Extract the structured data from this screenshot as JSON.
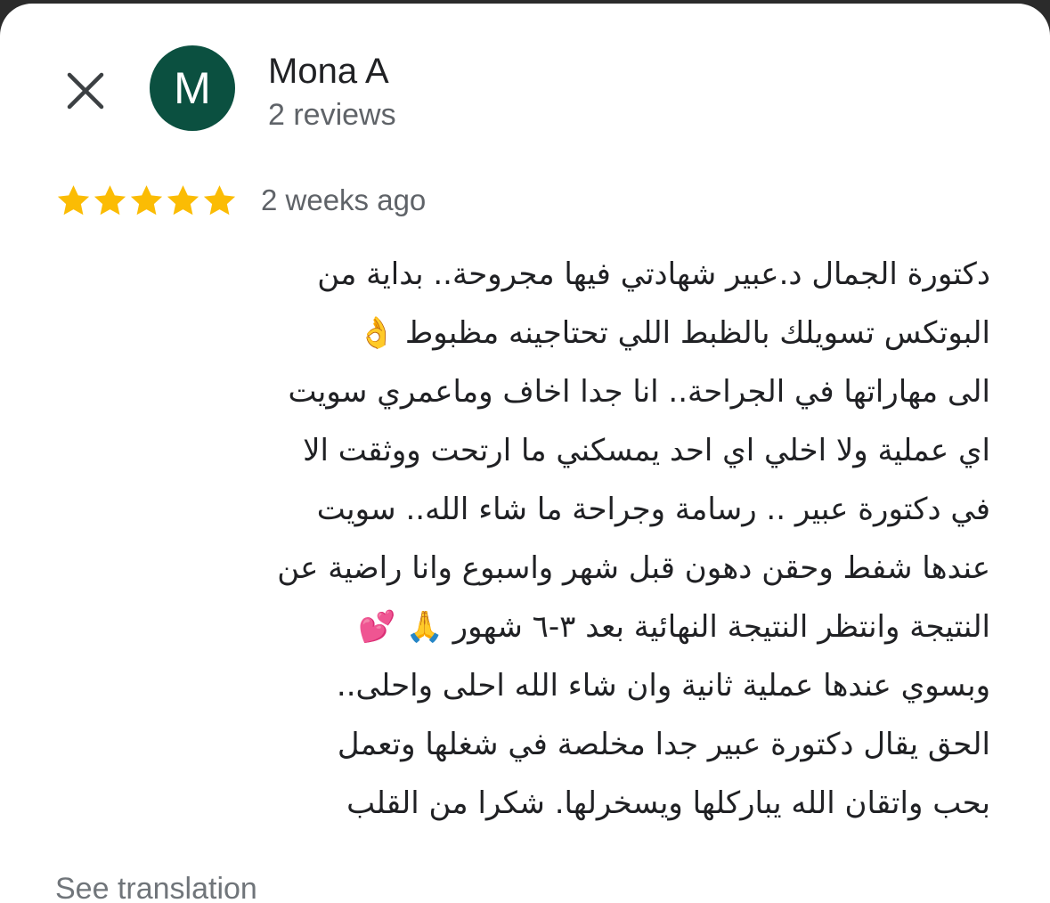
{
  "reviewer": {
    "name": "Mona A",
    "avatar_initial": "M",
    "review_count": "2 reviews"
  },
  "review": {
    "rating": 5,
    "rating_max": 5,
    "time_ago": "2 weeks ago",
    "text_lines": [
      "دكتورة الجمال د.عبير شهادتي فيها مجروحة.. بداية من",
      "البوتكس تسويلك بالظبط اللي تحتاجينه مظبوط 👌",
      "الى مهاراتها في الجراحة.. انا جدا اخاف وماعمري سويت",
      "اي عملية ولا اخلي اي احد يمسكني ما ارتحت ووثقت الا",
      "في دكتورة عبير .. رسامة وجراحة ما شاء الله.. سويت",
      "عندها شفط وحقن دهون  قبل شهر واسبوع وانا راضية عن",
      "النتيجة وانتظر النتيجة النهائية بعد ٣-٦ شهور 🙏 💕",
      "وبسوي عندها عملية ثانية وان شاء الله احلى واحلى..",
      "الحق يقال دكتورة عبير جدا مخلصة في شغلها وتعمل",
      "بحب واتقان الله يباركلها ويسخرلها. شكرا من القلب"
    ],
    "see_translation_label": "See translation"
  },
  "icons": {
    "close": "close-icon",
    "star": "star-icon"
  },
  "colors": {
    "avatar_bg": "#0b5040",
    "star": "#fbbc04",
    "text_primary": "#202124",
    "text_secondary": "#5f6368"
  }
}
